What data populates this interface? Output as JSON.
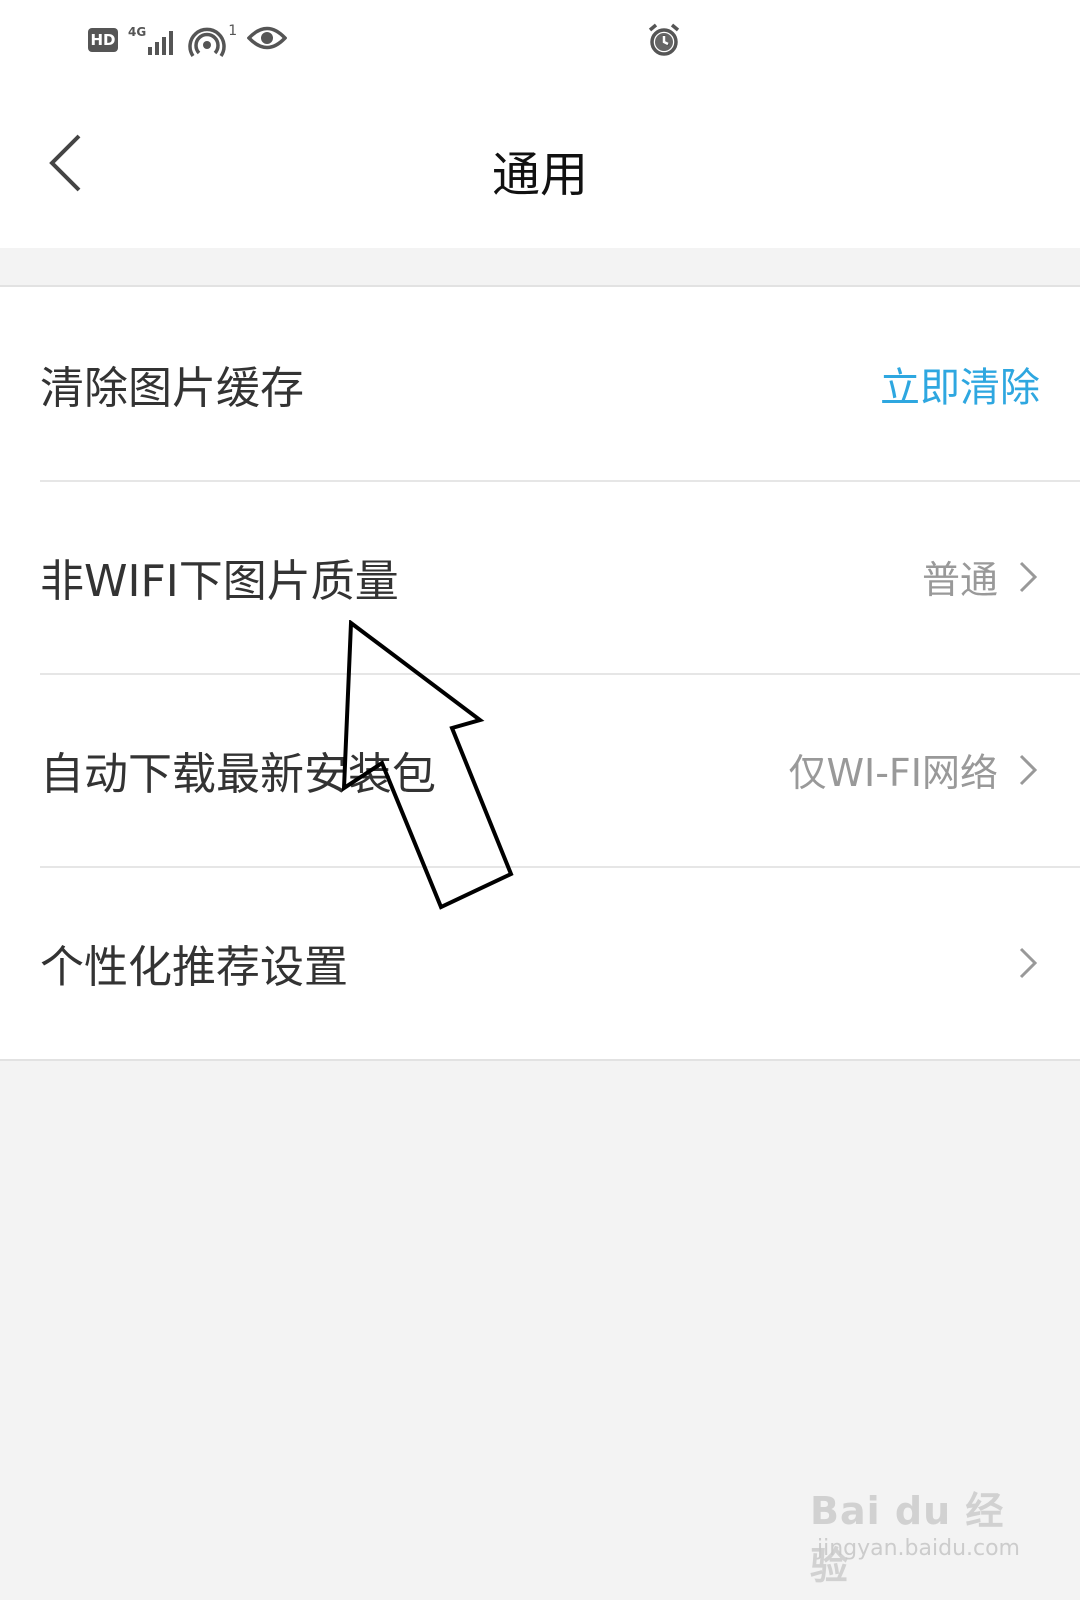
{
  "status_bar": {
    "badge": "HD",
    "network": "4G",
    "hotspot_count": "1",
    "icons": [
      "hd-icon",
      "signal-4g-icon",
      "hotspot-icon",
      "eye-icon",
      "alarm-icon"
    ]
  },
  "header": {
    "title": "通用",
    "back_icon": "chevron-left-icon"
  },
  "settings": {
    "items": [
      {
        "label": "清除图片缓存",
        "action": "立即清除"
      },
      {
        "label": "非WIFI下图片质量",
        "value": "普通"
      },
      {
        "label": "自动下载最新安装包",
        "value": "仅WI-FI网络"
      },
      {
        "label": "个性化推荐设置",
        "value": ""
      }
    ]
  },
  "watermark": {
    "brand": "Bai du 经验",
    "url": "jingyan.baidu.com"
  },
  "colors": {
    "accent": "#2ea7e0",
    "background": "#f3f3f3",
    "text_primary": "#333333",
    "text_secondary": "#999999"
  }
}
